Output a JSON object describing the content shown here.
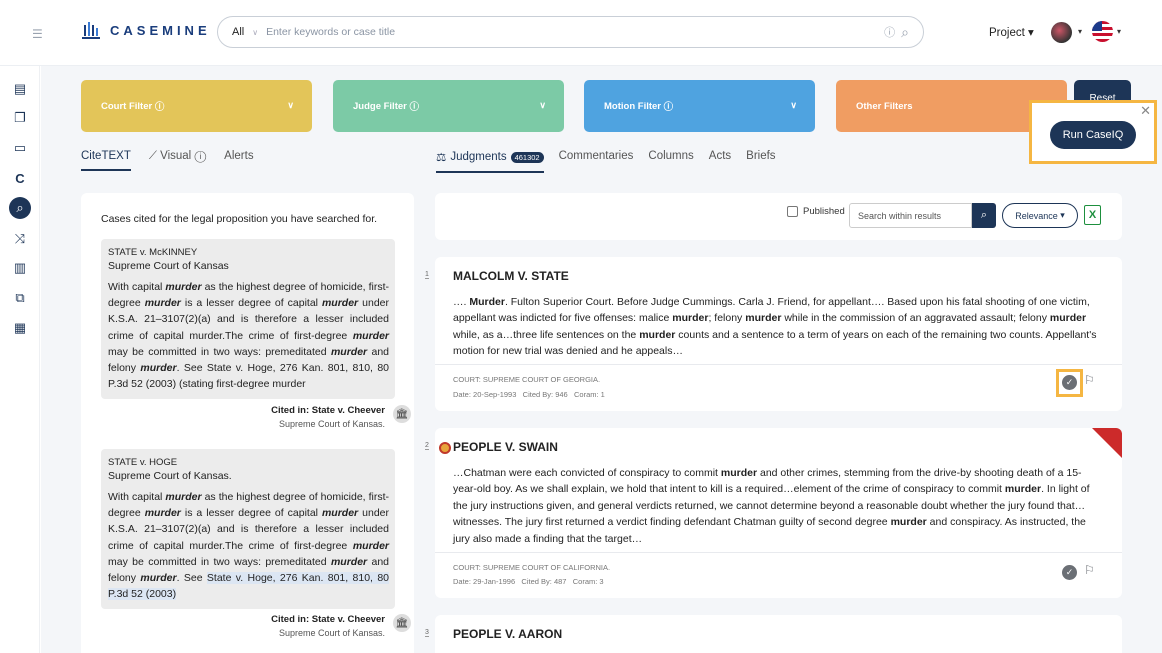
{
  "header": {
    "logo_text": "CASEMINE",
    "search_scope": "All",
    "search_placeholder": "Enter keywords or case title",
    "project_label": "Project"
  },
  "filters": {
    "court": "Court Filter",
    "judge": "Judge Filter",
    "motion": "Motion Filter",
    "other": "Other Filters",
    "reset": "Reset"
  },
  "caseiq": {
    "button": "Run CaseIQ"
  },
  "left_tabs": [
    "CiteTEXT",
    "Visual",
    "Alerts"
  ],
  "right_tabs": {
    "active": "Judgments",
    "count": "461302",
    "others": [
      "Commentaries",
      "Columns",
      "Acts",
      "Briefs"
    ]
  },
  "left_panel": {
    "intro": "Cases cited for the legal proposition you have searched for.",
    "cards": [
      {
        "title": "STATE v. McKINNEY",
        "court": "Supreme Court of Kansas",
        "cited_label": "Cited in:",
        "cited_case": "State v. Cheever",
        "cited_court": "Supreme Court of Kansas."
      },
      {
        "title": "STATE v. HOGE",
        "court": "Supreme Court of Kansas.",
        "cited_label": "Cited in:",
        "cited_case": "State v. Cheever",
        "cited_court": "Supreme Court of Kansas."
      }
    ]
  },
  "toolbar": {
    "published": "Published",
    "search_placeholder": "Search within results",
    "sort": "Relevance"
  },
  "results": [
    {
      "num": "1",
      "title": "MALCOLM V. STATE",
      "court": "COURT: SUPREME COURT OF GEORGIA.",
      "date_label": "Date:",
      "date": "20-Sep-1993",
      "cited_label": "Cited By:",
      "cited": "946",
      "coram_label": "Coram:",
      "coram": "1"
    },
    {
      "num": "2",
      "title": "PEOPLE V. SWAIN",
      "court": "COURT: SUPREME COURT OF CALIFORNIA.",
      "date_label": "Date:",
      "date": "29-Jan-1996",
      "cited_label": "Cited By:",
      "cited": "487",
      "coram_label": "Coram:",
      "coram": "3"
    },
    {
      "num": "3",
      "title": "PEOPLE V. AARON"
    }
  ]
}
